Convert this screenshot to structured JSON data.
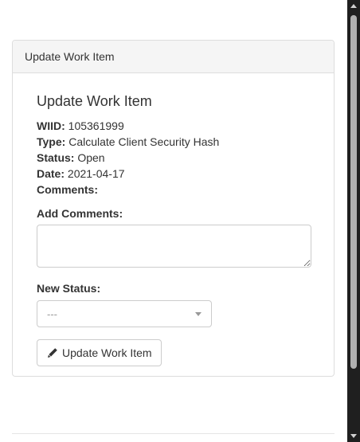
{
  "panel": {
    "heading": "Update Work Item",
    "form_title": "Update Work Item"
  },
  "details": {
    "wiid_label": "WIID:",
    "wiid": "105361999",
    "type_label": "Type:",
    "type": "Calculate Client Security Hash",
    "status_label": "Status:",
    "status": "Open",
    "date_label": "Date:",
    "date": "2021-04-17",
    "comments_label": "Comments:",
    "comments": ""
  },
  "form": {
    "add_comments_label": "Add Comments:",
    "add_comments_value": "",
    "new_status_label": "New Status:",
    "new_status_selected": "---",
    "submit_label": "Update Work Item",
    "submit_icon": "pencil-icon"
  },
  "colors": {
    "panel_heading_bg": "#f5f5f5",
    "border": "#dddddd",
    "scrollbar_track": "#1f1f1f",
    "scrollbar_thumb": "#b0b0b0"
  }
}
